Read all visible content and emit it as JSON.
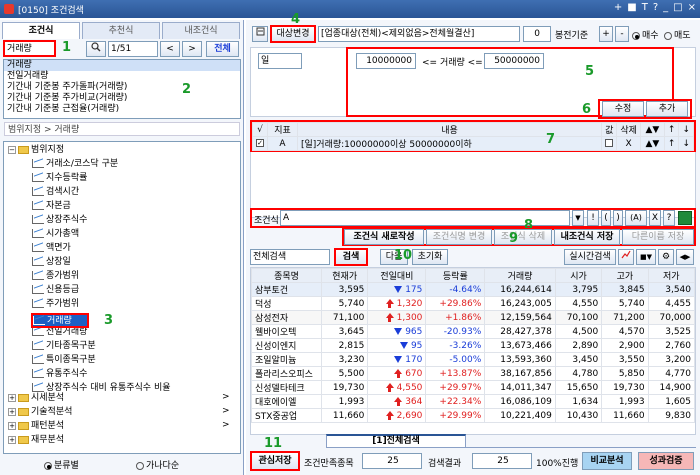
{
  "window": {
    "title": "[0150] 조건검색",
    "controls": [
      "+",
      "■",
      "T",
      "?",
      "_",
      "□",
      "×"
    ]
  },
  "left": {
    "tabs": [
      "조건식",
      "추천식",
      "내조건식"
    ],
    "search": {
      "value": "거래량",
      "page": "1/51",
      "prev": "<",
      "next": ">",
      "all": "전체"
    },
    "list_items": [
      "거래량",
      "전일거래량",
      "기간내 기준봉 주가돌파(거래량)",
      "기간내 기준봉 주가비교(거래량)",
      "기간내 기준봉 근접율(거래량)"
    ],
    "breadcrumb": "범위지정 > 거래량",
    "tree": {
      "root": "범위지정",
      "children": [
        "거래소/코스닥 구분",
        "지수등락률",
        "검색시간",
        "자본금",
        "상장주식수",
        "시가총액",
        "액면가",
        "상장일",
        "종가범위",
        "신용등급",
        "주가범위",
        "거래량",
        "전일거래량",
        "기타종목구분",
        "특이종목구분",
        "유통주식수",
        "상장주식수 대비 유통주식수 비율"
      ],
      "folders": [
        "시세분석",
        "기술적분석",
        "패턴분석",
        "재무분석"
      ],
      "more": ">"
    },
    "footer": {
      "opt1": "분류별",
      "opt2": "가나다순"
    }
  },
  "right": {
    "target_btn": "대상변경",
    "target_text": "[업종대상(전체)<제외없음>전체월결산]",
    "spin": "0",
    "bong": "봉전기준",
    "plus": "+",
    "minus": "-",
    "buy": "매수",
    "sell": "매도",
    "period": "일",
    "range_min": "10000000",
    "range_lbl": "<= 거래량 <=",
    "range_max": "50000000",
    "modify": "수정",
    "add": "추가",
    "cond_headers": [
      "√",
      "지표",
      "내용",
      "값",
      "삭제",
      "▲▼",
      "↑",
      "↓"
    ],
    "cond_row": {
      "letter": "A",
      "content": "[일]거래량:10000000이상 50000000이하",
      "del": "X",
      "updown": "▲▼",
      "up": "↑",
      "down": "↓"
    },
    "cond_label": "조건식",
    "cond_value": "A",
    "ops": [
      "!",
      "(",
      ")",
      "(A)",
      "X",
      "?"
    ],
    "actions": [
      "조건식 새로작성",
      "조건식명 변경",
      "조건식 삭제",
      "내조건식 저장",
      "다른이름 저장"
    ],
    "search_scope": "전체검색",
    "search_btn": "검색",
    "next_btn": "다음",
    "reset_btn": "초기화",
    "realtime": "실시간검색",
    "table_headers": [
      "종목명",
      "현재가",
      "전일대비",
      "등락률",
      "거래량",
      "시가",
      "고가",
      "저가"
    ],
    "rows": [
      {
        "name": "삼부토건",
        "price": "3,595",
        "dir": "down",
        "chg": "175",
        "rate": "-4.64%",
        "vol": "16,244,614",
        "open": "3,795",
        "high": "3,845",
        "low": "3,540"
      },
      {
        "name": "덕성",
        "price": "5,740",
        "dir": "up",
        "chg": "1,320",
        "rate": "+29.86%",
        "vol": "16,243,005",
        "open": "4,550",
        "high": "5,740",
        "low": "4,455"
      },
      {
        "name": "삼성전자",
        "price": "71,100",
        "dir": "up",
        "chg": "1,300",
        "rate": "+1.86%",
        "vol": "12,159,564",
        "open": "70,100",
        "high": "71,200",
        "low": "70,000"
      },
      {
        "name": "웰바이오텍",
        "price": "3,645",
        "dir": "down",
        "chg": "965",
        "rate": "-20.93%",
        "vol": "28,427,378",
        "open": "4,500",
        "high": "4,570",
        "low": "3,525"
      },
      {
        "name": "신성이엔지",
        "price": "2,815",
        "dir": "down",
        "chg": "95",
        "rate": "-3.26%",
        "vol": "13,673,466",
        "open": "2,890",
        "high": "2,900",
        "low": "2,760"
      },
      {
        "name": "조일알미늄",
        "price": "3,230",
        "dir": "down",
        "chg": "170",
        "rate": "-5.00%",
        "vol": "13,593,360",
        "open": "3,450",
        "high": "3,550",
        "low": "3,200"
      },
      {
        "name": "폴라리스오피스",
        "price": "5,500",
        "dir": "up",
        "chg": "670",
        "rate": "+13.87%",
        "vol": "38,167,856",
        "open": "4,780",
        "high": "5,850",
        "low": "4,770"
      },
      {
        "name": "신성델타테크",
        "price": "19,730",
        "dir": "up",
        "chg": "4,550",
        "rate": "+29.97%",
        "vol": "14,011,347",
        "open": "15,650",
        "high": "19,730",
        "low": "14,900"
      },
      {
        "name": "대호에이엘",
        "price": "1,993",
        "dir": "up",
        "chg": "364",
        "rate": "+22.34%",
        "vol": "16,086,109",
        "open": "1,634",
        "high": "1,993",
        "low": "1,605"
      },
      {
        "name": "STX중공업",
        "price": "11,660",
        "dir": "up",
        "chg": "2,690",
        "rate": "+29.99%",
        "vol": "10,221,409",
        "open": "10,430",
        "high": "11,660",
        "low": "9,830"
      }
    ],
    "result_tab": "[1]전체검색",
    "footer": {
      "save": "관심저장",
      "cond_count_lbl": "조건만족종목",
      "cond_count": "25",
      "result_lbl": "검색결과",
      "result": "25",
      "progress": "100%진행",
      "compare": "비교분석",
      "verify": "성과검증"
    }
  },
  "markers": [
    "1",
    "2",
    "3",
    "4",
    "5",
    "6",
    "7",
    "8",
    "9",
    "10",
    "11"
  ],
  "colors": {
    "accent": "#2a5595",
    "marker": "#1a9a2a",
    "highlight": "#ff0000",
    "up": "#e02020",
    "down": "#1a3dd8"
  }
}
